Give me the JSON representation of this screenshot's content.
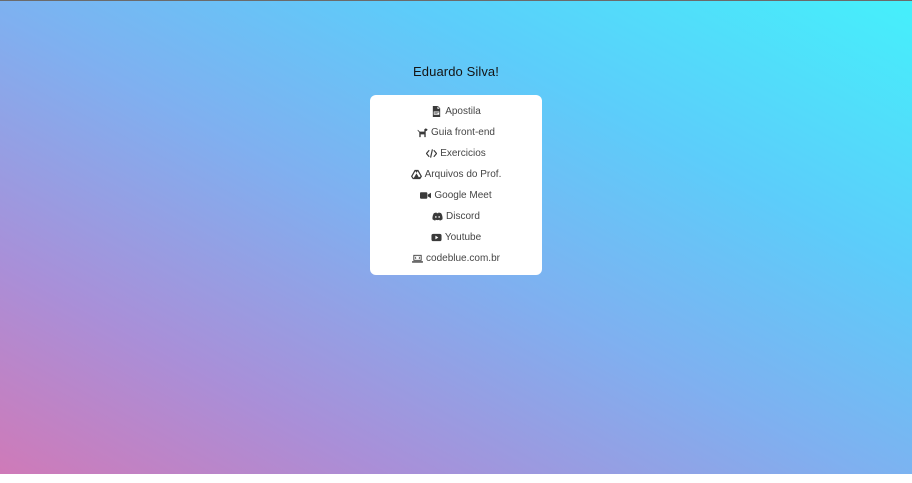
{
  "profile": {
    "name": "Eduardo Silva!"
  },
  "links": [
    {
      "label": "Apostila",
      "icon": "file-pdf-icon"
    },
    {
      "label": "Guia front-end",
      "icon": "dog-icon"
    },
    {
      "label": "Exercicios",
      "icon": "code-icon"
    },
    {
      "label": "Arquivos do Prof.",
      "icon": "google-drive-icon"
    },
    {
      "label": "Google Meet",
      "icon": "video-icon"
    },
    {
      "label": "Discord",
      "icon": "discord-icon"
    },
    {
      "label": "Youtube",
      "icon": "youtube-icon"
    },
    {
      "label": "codeblue.com.br",
      "icon": "laptop-code-icon"
    }
  ],
  "colors": {
    "gradient_start": "#cf7ab8",
    "gradient_end": "#45f0fb",
    "card": "#ffffff",
    "text": "#454545"
  }
}
